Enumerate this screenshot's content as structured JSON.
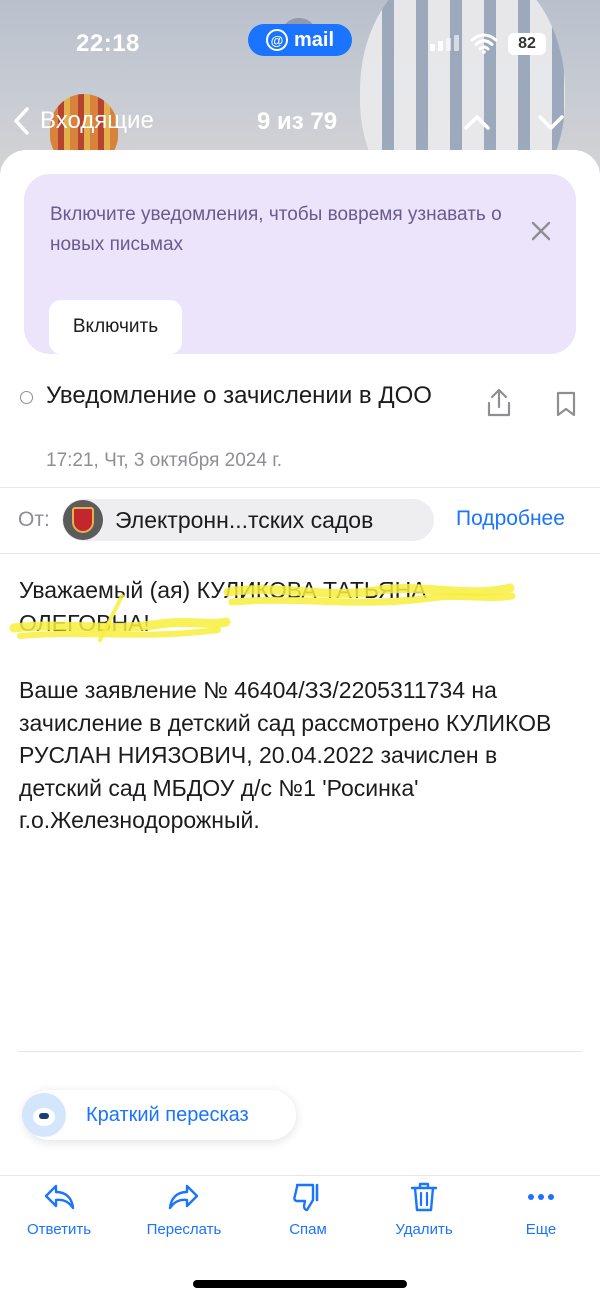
{
  "status_bar": {
    "time": "22:18",
    "app_badge": "mail",
    "battery": "82"
  },
  "nav": {
    "back_label": "Входящие",
    "counter": "9 из 79"
  },
  "notification": {
    "text": "Включите уведомления, чтобы вовремя узнавать о новых письмах",
    "button_label": "Включить"
  },
  "message": {
    "subject": "Уведомление о зачислении в ДОО",
    "date": "17:21, Чт, 3 октября 2024 г.",
    "from_label": "От:",
    "sender": "Электронн...тских садов",
    "details_link": "Подробнее",
    "greeting": "Уважаемый (ая) КУЛИКОВА ТАТЬЯНА ОЛЕГОВНА!",
    "body": "Ваше заявление № 46404/ЗЗ/2205311734 на зачисление в детский сад рассмотрено КУЛИКОВ РУСЛАН НИЯЗОВИЧ, 20.04.2022 зачислен в детский сад МБДОУ д/с №1 'Росинка' г.о.Железнодорожный."
  },
  "summary_button": "Краткий пересказ",
  "toolbar": {
    "reply": "Ответить",
    "forward": "Переслать",
    "spam": "Спам",
    "delete": "Удалить",
    "more": "Еще"
  },
  "colors": {
    "accent": "#1a74ff",
    "banner_bg": "#ece4fb",
    "highlight": "#f7ef3c"
  }
}
